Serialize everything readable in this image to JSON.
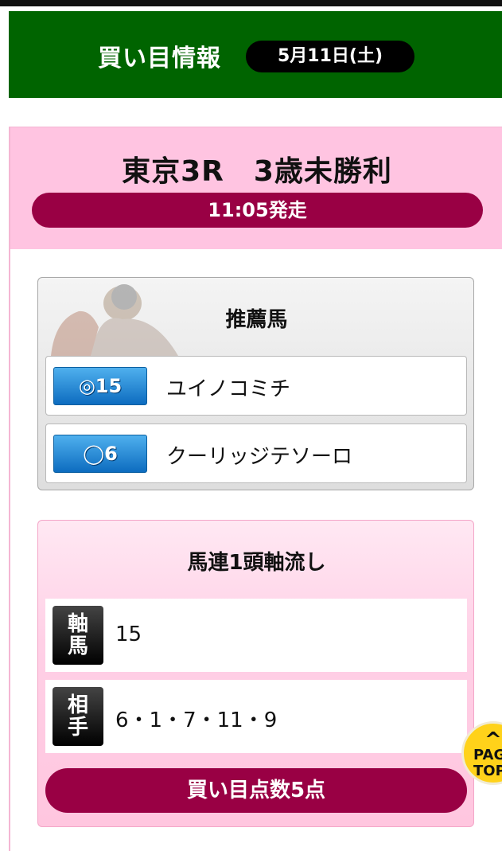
{
  "header": {
    "title": "買い目情報",
    "date": "5月11日(土)"
  },
  "race": {
    "title": "東京3R　3歳未勝利",
    "start_time": "11:05発走"
  },
  "recommended": {
    "title": "推薦馬",
    "horses": [
      {
        "badge": "◎15",
        "name": "ユイノコミチ"
      },
      {
        "badge": "◯6",
        "name": "クーリッジテソーロ"
      }
    ]
  },
  "bet": {
    "title": "馬連1頭軸流し",
    "rows": [
      {
        "label": "軸馬",
        "value": "15"
      },
      {
        "label": "相手",
        "value": "6・1・7・11・9"
      }
    ],
    "total": "買い目点数5点"
  },
  "page_top": {
    "arrow": "^",
    "label": "PAGE TOP"
  },
  "colors": {
    "header_green": "#006400",
    "race_pink": "#ffc4e1",
    "accent_crimson": "#990044",
    "badge_blue": "#0d6cc0"
  }
}
